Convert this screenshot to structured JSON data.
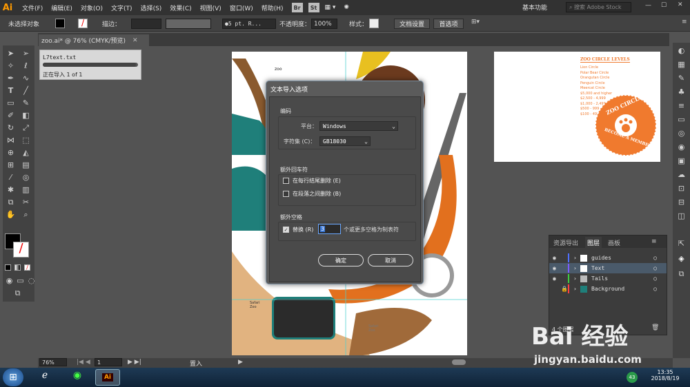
{
  "app": {
    "logo": "Ai"
  },
  "menu": [
    "文件(F)",
    "编辑(E)",
    "对象(O)",
    "文字(T)",
    "选择(S)",
    "效果(C)",
    "视图(V)",
    "窗口(W)",
    "帮助(H)"
  ],
  "menu_badges": [
    "Br",
    "St"
  ],
  "workspace": {
    "label": "基本功能",
    "search_placeholder": "搜索 Adobe Stock"
  },
  "control": {
    "selection": "未选择对象",
    "stroke_label": "描边：",
    "brush": "5 pt. R...",
    "opacity_label": "不透明度：",
    "opacity_value": "100%",
    "style_label": "样式：",
    "doc_setup": "文档设置",
    "prefs": "首选项"
  },
  "doc_tab": "zoo.ai* @ 76% (CMYK/预览)",
  "progress": {
    "file": "L7text.txt",
    "status": "正在导入 1 of 1",
    "fraction": 0.98
  },
  "artboard": {
    "small_label": "zoo",
    "safari": "Safari\nZoo",
    "photo_label": "Safari\nZoo"
  },
  "preview": {
    "title": "ZOO CIRCLE LEVELS",
    "levels": [
      "Lion Circle",
      "Polar Bear Circle",
      "Orangutan Circle",
      "Penguin Circle",
      "Meercat Circle",
      "$5,000  and higher",
      "$2,500 - 4,999",
      "$1,000 - 2,499",
      "$500 - 999",
      "$100 - 499"
    ],
    "badge_top": "ZOO CIRCLE",
    "badge_bottom": "BECOME A MEMBER"
  },
  "dialog": {
    "title": "文本导入选项",
    "encoding_label": "编码",
    "platform_label": "平台：",
    "platform_value": "Windows",
    "charset_label": "字符集 (C)：",
    "charset_value": "GB18030",
    "returns_label": "额外回车符",
    "remove_eol": "在每行结尾删除 (E)",
    "remove_para": "在段落之间删除 (B)",
    "spaces_label": "额外空格",
    "replace_label": "替换 (R)",
    "replace_value": "3",
    "replace_suffix": "个或更多空格为制表符",
    "ok": "确定",
    "cancel": "取消"
  },
  "layers_panel": {
    "tabs": [
      "资源导出",
      "图层",
      "画板"
    ],
    "layers": [
      {
        "name": "guides",
        "color": "#4f6fff"
      },
      {
        "name": "Text",
        "color": "#7a5cff"
      },
      {
        "name": "Tails",
        "color": "#3fcf3f"
      },
      {
        "name": "Background",
        "color": "#ff4040"
      }
    ],
    "count": "4 个图层"
  },
  "status": {
    "zoom": "76%",
    "page": "1",
    "tool": "置入"
  },
  "taskbar": {
    "time": "13:35",
    "date": "2018/8/19",
    "badge": "43"
  },
  "watermark": {
    "brand": "Bai 经验",
    "url": "jingyan.baidu.com"
  },
  "colors": {
    "accent": "#ff9a00",
    "orange": "#f07a2e",
    "teal": "#1f7f7a",
    "brown": "#8a5a2e"
  }
}
